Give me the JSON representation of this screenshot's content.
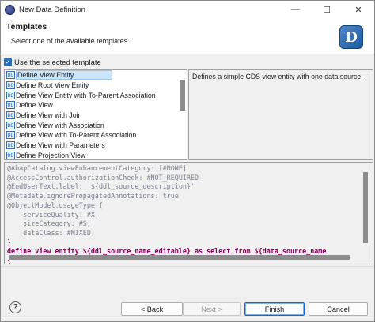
{
  "window": {
    "title": "New Data Definition",
    "controls": {
      "minimize": "—",
      "maximize": "☐",
      "close": "✕"
    }
  },
  "header": {
    "title": "Templates",
    "description": "Select one of the available templates.",
    "logo_letter": "D"
  },
  "use_template": {
    "label": "Use the selected template",
    "checked": true,
    "check_glyph": "✓"
  },
  "templates": [
    {
      "label": "Define View Entity",
      "selected": true
    },
    {
      "label": "Define Root View Entity",
      "selected": false
    },
    {
      "label": "Define View Entity with To-Parent Association",
      "selected": false
    },
    {
      "label": "Define View",
      "selected": false
    },
    {
      "label": "Define View with Join",
      "selected": false
    },
    {
      "label": "Define View with Association",
      "selected": false
    },
    {
      "label": "Define View with To-Parent Association",
      "selected": false
    },
    {
      "label": "Define View with Parameters",
      "selected": false
    },
    {
      "label": "Define Projection View",
      "selected": false
    }
  ],
  "template_icon_text": "DD",
  "description_text": "Defines a simple CDS view entity with one data source.",
  "code_preview": [
    {
      "text": "@AbapCatalog.viewEnhancementCategory: [#NONE]",
      "kind": "ann"
    },
    {
      "text": "@AccessControl.authorizationCheck: #NOT_REQUIRED",
      "kind": "ann"
    },
    {
      "text": "@EndUserText.label: '${ddl_source_description}'",
      "kind": "ann"
    },
    {
      "text": "@Metadata.ignorePropagatedAnnotations: true",
      "kind": "ann"
    },
    {
      "text": "@ObjectModel.usageType:{",
      "kind": "ann"
    },
    {
      "text": "    serviceQuality: #X,",
      "kind": "ann"
    },
    {
      "text": "    sizeCategory: #S,",
      "kind": "ann"
    },
    {
      "text": "    dataClass: #MIXED",
      "kind": "ann"
    },
    {
      "text": "}",
      "kind": "sym"
    },
    {
      "text": "define view entity ${ddl_source_name_editable} as select from ${data_source_name",
      "kind": "kw"
    },
    {
      "text": "{",
      "kind": "sym"
    }
  ],
  "footer": {
    "help_glyph": "?",
    "back_label": "< Back",
    "next_label": "Next >",
    "finish_label": "Finish",
    "cancel_label": "Cancel"
  }
}
